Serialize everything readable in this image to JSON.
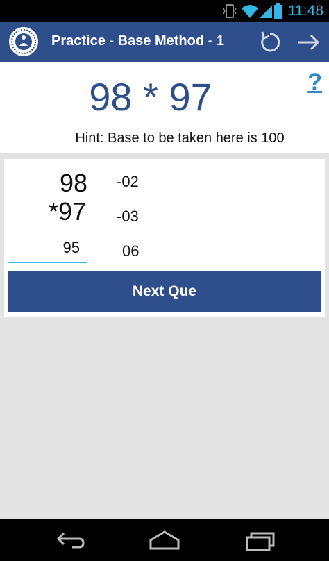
{
  "status_bar": {
    "time": "11:48",
    "icons": [
      "vibrate-icon",
      "wifi-icon",
      "signal-icon",
      "battery-icon"
    ]
  },
  "action_bar": {
    "title": "Practice - Base Method - 1",
    "icons": [
      "app-logo-icon",
      "refresh-icon",
      "arrow-right-icon"
    ]
  },
  "question": {
    "expression": "98 * 97",
    "help_label": "?",
    "hint": "Hint: Base to be taken here is 100"
  },
  "work": {
    "number1": "98",
    "number2": "*97",
    "deviation1": "-02",
    "deviation2": "-03",
    "answer_left": "95",
    "answer_right": "06"
  },
  "buttons": {
    "next_label": "Next Que"
  },
  "nav_bar": {
    "icons": [
      "back-icon",
      "home-icon",
      "recent-apps-icon"
    ]
  },
  "colors": {
    "primary": "#2e4f8c",
    "accent": "#33b5e5",
    "background": "#e3e3e3"
  }
}
